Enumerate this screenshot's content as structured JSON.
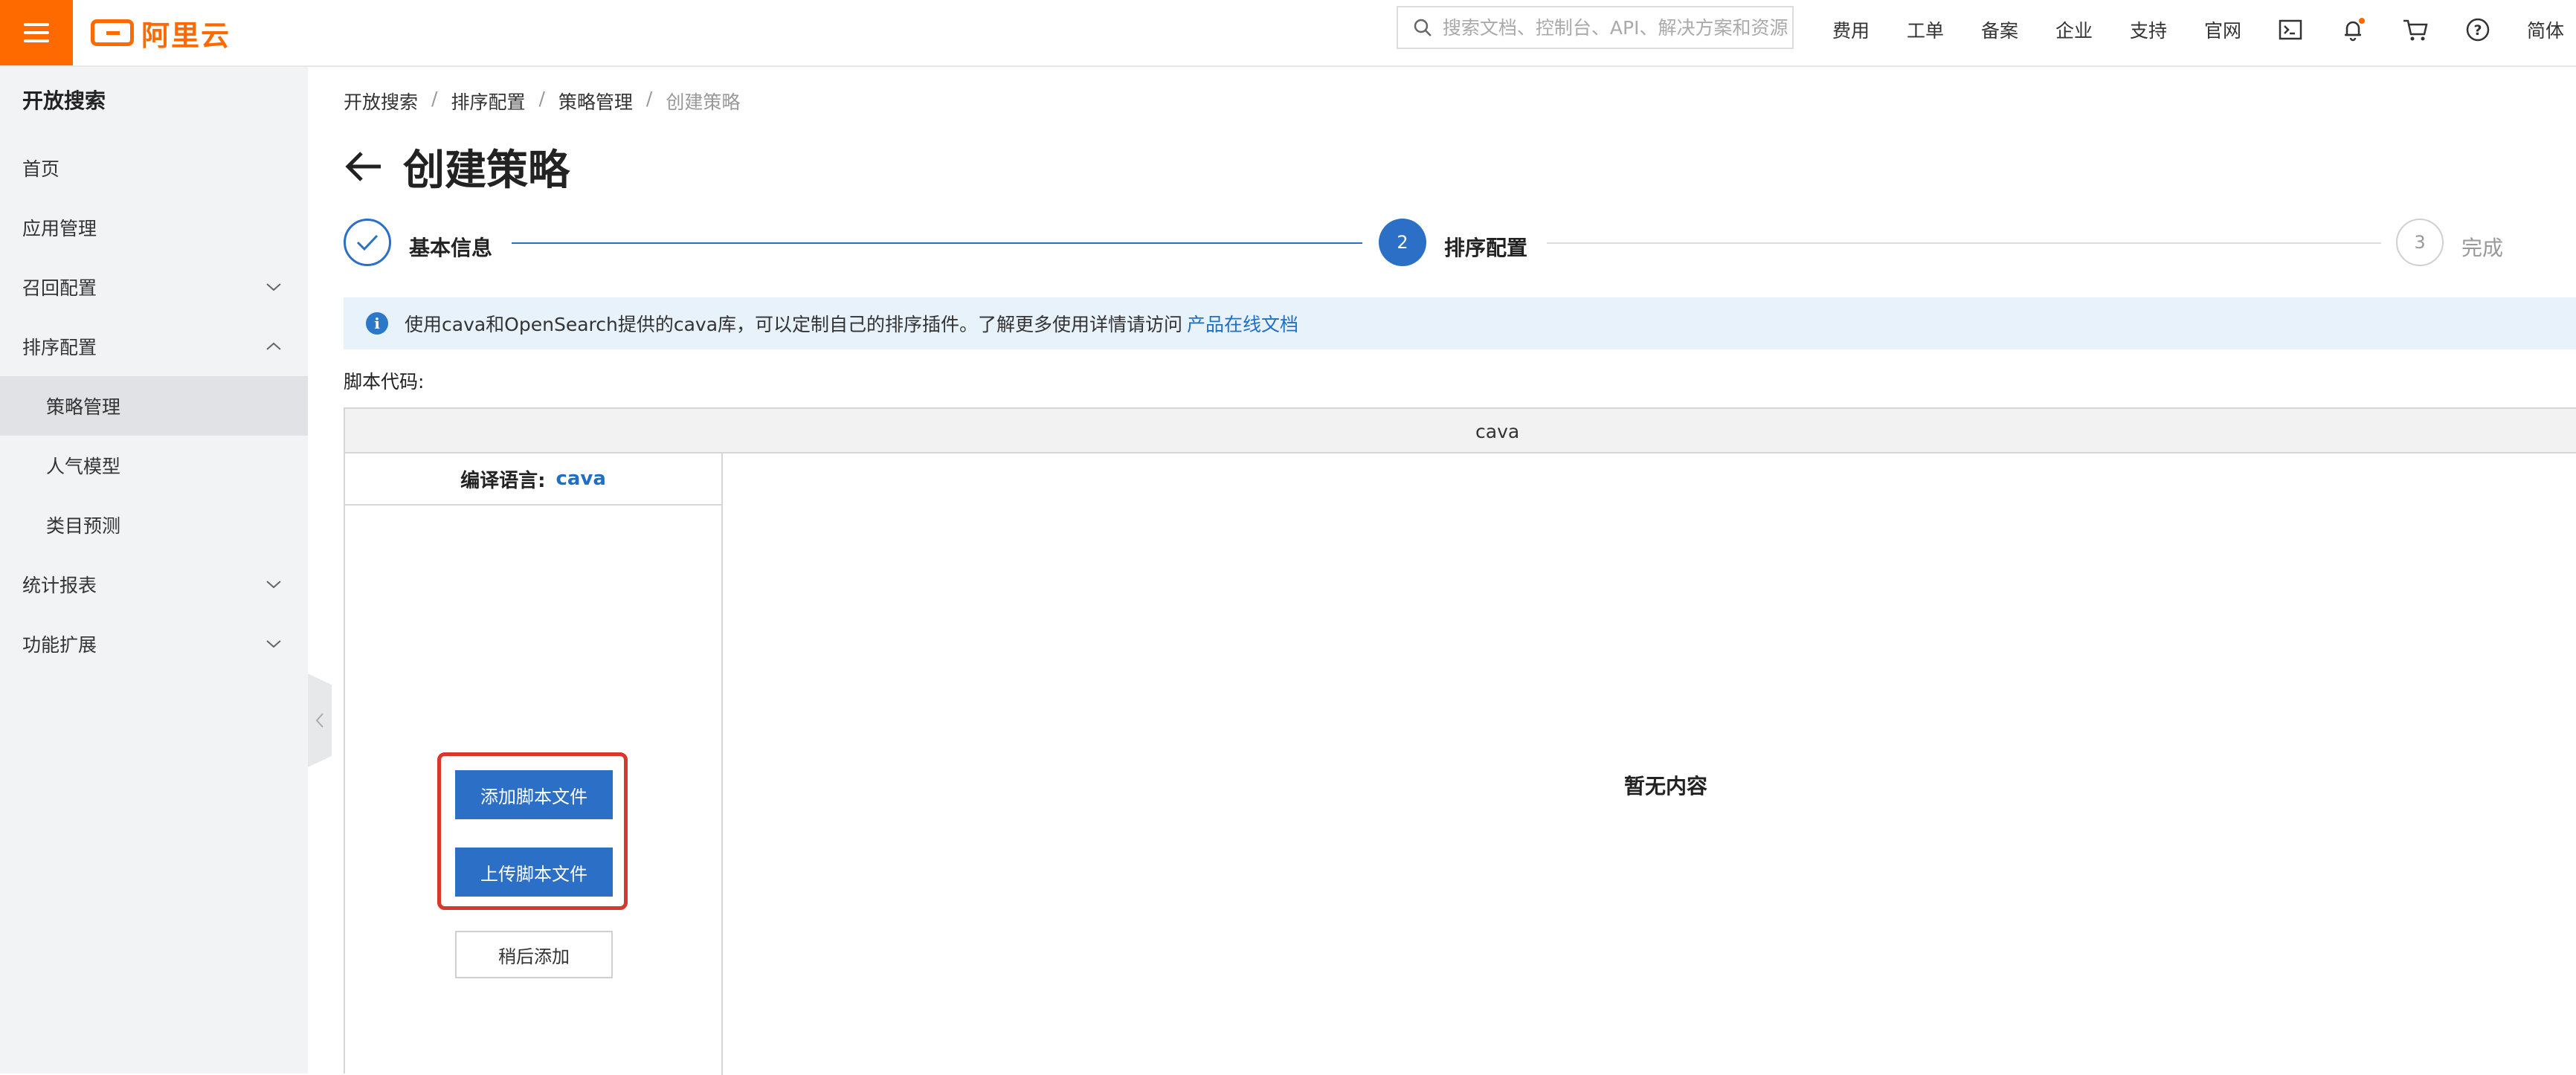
{
  "topbar": {
    "logo_text": "阿里云",
    "search_placeholder": "搜索文档、控制台、API、解决方案和资源",
    "nav": [
      "费用",
      "工单",
      "备案",
      "企业",
      "支持",
      "官网"
    ],
    "lang": "简体",
    "accent": "#ff6a00"
  },
  "sidebar": {
    "title": "开放搜索",
    "items": [
      {
        "label": "首页"
      },
      {
        "label": "应用管理"
      },
      {
        "label": "召回配置"
      },
      {
        "label": "排序配置"
      },
      {
        "label": "策略管理"
      },
      {
        "label": "人气模型"
      },
      {
        "label": "类目预测"
      },
      {
        "label": "统计报表"
      },
      {
        "label": "功能扩展"
      }
    ]
  },
  "breadcrumb": [
    "开放搜索",
    "排序配置",
    "策略管理",
    "创建策略"
  ],
  "page_title": "创建策略",
  "steps": [
    {
      "label": "基本信息",
      "status": "done"
    },
    {
      "number": "2",
      "label": "排序配置",
      "status": "active"
    },
    {
      "number": "3",
      "label": "完成",
      "status": "pending"
    }
  ],
  "notice": {
    "text": "使用cava和OpenSearch提供的cava库，可以定制自己的排序插件。了解更多使用详情请访问",
    "link": "产品在线文档"
  },
  "code_label": "脚本代码:",
  "editor": {
    "header": "cava",
    "lang_label": "编译语言:",
    "lang_value": "cava",
    "add_button": "添加脚本文件",
    "upload_button": "上传脚本文件",
    "later_button": "稍后添加",
    "empty_text": "暂无内容"
  }
}
